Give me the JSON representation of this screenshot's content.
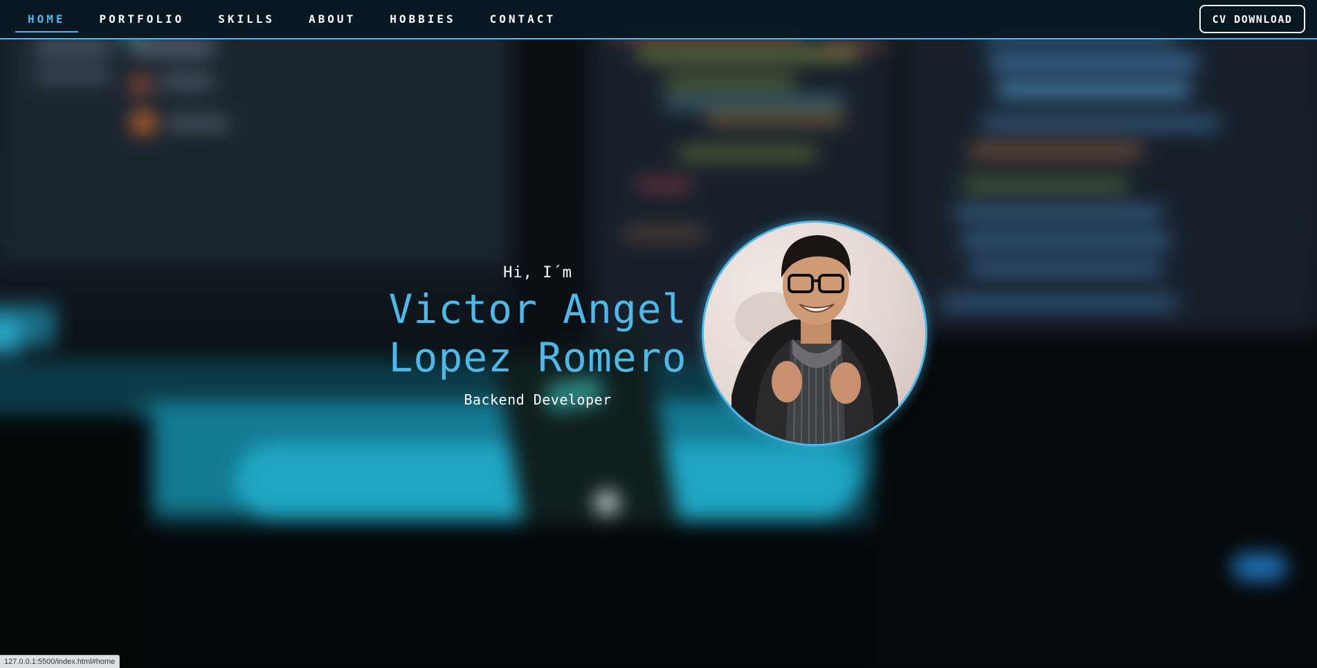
{
  "nav": {
    "items": [
      {
        "label": "HOME",
        "active": true
      },
      {
        "label": "PORTFOLIO",
        "active": false
      },
      {
        "label": "SKILLS",
        "active": false
      },
      {
        "label": "ABOUT",
        "active": false
      },
      {
        "label": "HOBBIES",
        "active": false
      },
      {
        "label": "CONTACT",
        "active": false
      }
    ],
    "cv_button_label": "CV DOWNLOAD"
  },
  "hero": {
    "greeting": "Hi, I´m",
    "name_line1": "Victor Angel",
    "name_line2": "Lopez Romero",
    "role": "Backend Developer"
  },
  "status_bar": {
    "url": "127.0.0.1:5500/index.html#home"
  },
  "colors": {
    "accent": "#4fb8e8",
    "navbar_bg": "#081822",
    "text": "#ffffff"
  }
}
